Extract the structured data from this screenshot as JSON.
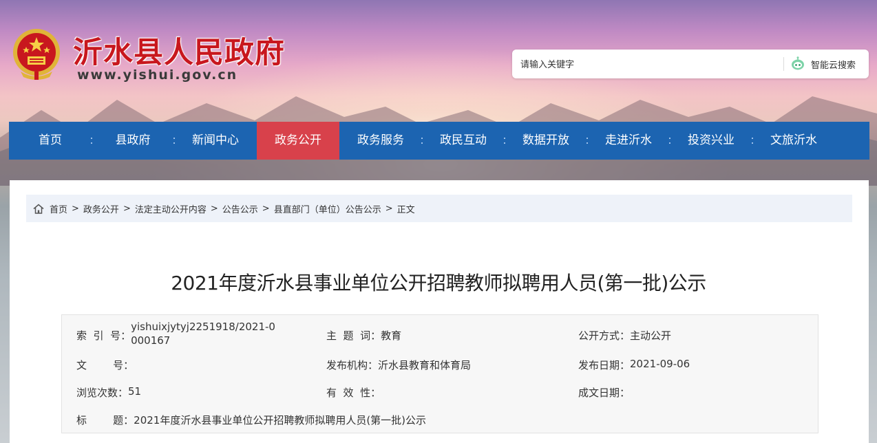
{
  "header": {
    "site_name": "沂水县人民政府",
    "site_url": "www.yishui.gov.cn"
  },
  "search": {
    "placeholder": "请输入关键字",
    "button_label": "智能云搜索"
  },
  "nav": {
    "items": [
      {
        "label": "首页",
        "active": false
      },
      {
        "label": "县政府",
        "active": false
      },
      {
        "label": "新闻中心",
        "active": false
      },
      {
        "label": "政务公开",
        "active": true
      },
      {
        "label": "政务服务",
        "active": false
      },
      {
        "label": "政民互动",
        "active": false
      },
      {
        "label": "数据开放",
        "active": false
      },
      {
        "label": "走进沂水",
        "active": false
      },
      {
        "label": "投资兴业",
        "active": false
      },
      {
        "label": "文旅沂水",
        "active": false
      }
    ]
  },
  "breadcrumb": {
    "items": [
      "首页",
      "政务公开",
      "法定主动公开内容",
      "公告公示",
      "县直部门（单位）公告公示",
      "正文"
    ],
    "separator": ">"
  },
  "article": {
    "title": "2021年度沂水县事业单位公开招聘教师拟聘用人员(第一批)公示"
  },
  "meta": {
    "index_label": "索  引  号：",
    "index_value": "yishuixjytyj2251918/2021-0000167",
    "topic_label": "主  题  词：",
    "topic_value": "教育",
    "open_method_label": "公开方式：",
    "open_method_value": "主动公开",
    "doc_no_label": "文        号：",
    "doc_no_value": "",
    "publisher_label": "发布机构：",
    "publisher_value": "沂水县教育和体育局",
    "publish_date_label": "发布日期：",
    "publish_date_value": "2021-09-06",
    "views_label": "浏览次数：",
    "views_value": "51",
    "validity_label": "有  效  性：",
    "validity_value": "",
    "created_date_label": "成文日期：",
    "created_date_value": "",
    "title_label": "标        题：",
    "title_value": "2021年度沂水县事业单位公开招聘教师拟聘用人员(第一批)公示"
  },
  "colors": {
    "nav_bg": "#1c64b1",
    "nav_active": "#d8414b",
    "brand_red": "#c8171e",
    "breadcrumb_bg": "#eef2f9"
  },
  "icons": {
    "emblem": "national-emblem-icon",
    "search": "robot-search-icon",
    "home": "home-icon"
  }
}
